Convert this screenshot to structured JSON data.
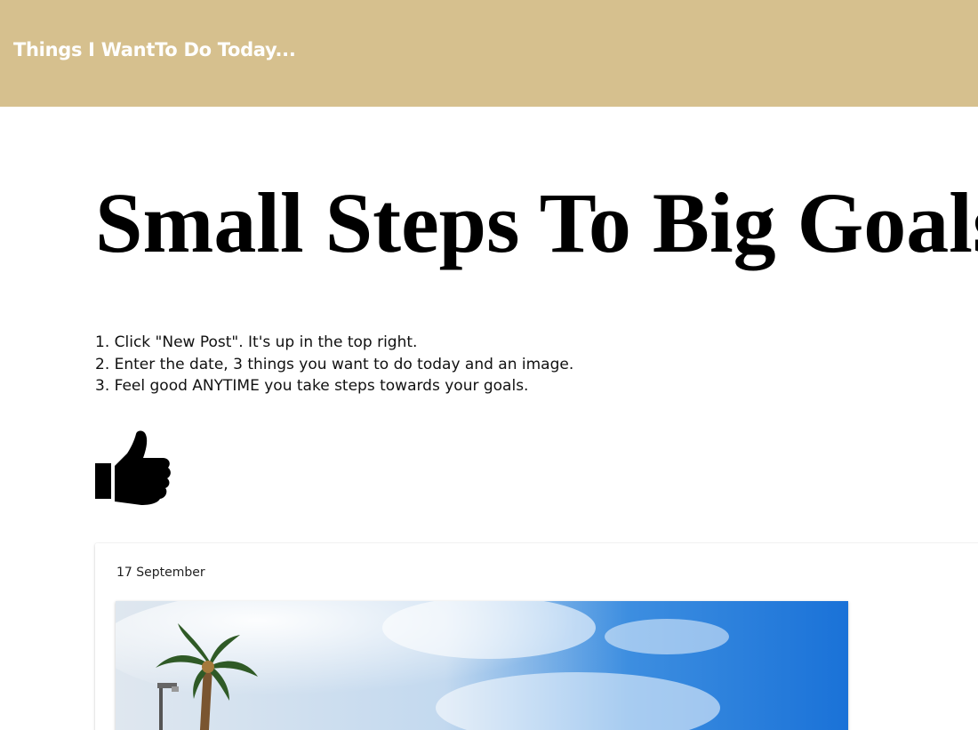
{
  "header": {
    "title": "Things I WantTo Do Today...",
    "background_color": "#d6c08e"
  },
  "main": {
    "headline": "Small Steps To Big Goals",
    "instructions": [
      "1. Click \"New Post\". It's up in the top right.",
      "2. Enter the date, 3 things you want to do today and an image.",
      "3. Feel good ANYTIME you take steps towards your goals."
    ],
    "thumb_icon": "thumbs-up-icon"
  },
  "post": {
    "date": "17 September",
    "image": "palm-trees-blue-sky-photo"
  }
}
